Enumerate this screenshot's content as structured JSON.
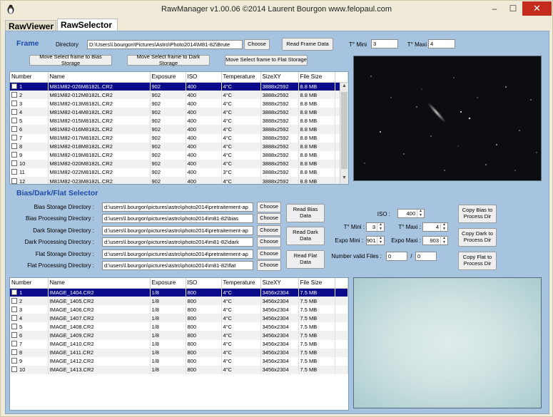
{
  "window": {
    "title": "RawManager v1.00.06 ©2014 Laurent Bourgon  www.felopaul.com",
    "minimize": "–",
    "maximize": "☐",
    "close": "✕"
  },
  "tabs": [
    {
      "label": "RawViewer",
      "active": false
    },
    {
      "label": "RawSelector",
      "active": true
    }
  ],
  "frame": {
    "section_title": "Frame",
    "directory_label": "Directory",
    "directory_value": "D:\\Users\\l.bourgon\\Pictures\\Astro\\Photo2014\\M81-82\\Brute",
    "choose_label": "Choose",
    "read_label": "Read Frame Data",
    "tmin_label": "T° Mini",
    "tmin_value": "3",
    "tmax_label": "T° Maxi",
    "tmax_value": "4",
    "move_bias_label": "Move Select frame to Bias Storage",
    "move_dark_label": "Move Select frame to Dark Storage",
    "move_flat_label": "Move Select frame to Flat Storage"
  },
  "frame_table": {
    "columns": [
      "Number",
      "Name",
      "Exposure",
      "ISO",
      "Temperature",
      "SizeXY",
      "File Size"
    ],
    "rows": [
      [
        "1",
        "M81M82-026M8182L.CR2",
        "902",
        "400",
        "4°C",
        "3888x2592",
        "8.8 MB"
      ],
      [
        "2",
        "M81M82-012M8182L.CR2",
        "902",
        "400",
        "4°C",
        "3888x2592",
        "8.8 MB"
      ],
      [
        "3",
        "M81M82-013M8182L.CR2",
        "902",
        "400",
        "4°C",
        "3888x2592",
        "8.8 MB"
      ],
      [
        "4",
        "M81M82-014M8182L.CR2",
        "902",
        "400",
        "4°C",
        "3888x2592",
        "8.8 MB"
      ],
      [
        "5",
        "M81M82-015M8182L.CR2",
        "902",
        "400",
        "4°C",
        "3888x2592",
        "8.8 MB"
      ],
      [
        "6",
        "M81M82-016M8182L.CR2",
        "902",
        "400",
        "4°C",
        "3888x2592",
        "8.8 MB"
      ],
      [
        "7",
        "M81M82-017M8182L.CR2",
        "902",
        "400",
        "4°C",
        "3888x2592",
        "8.8 MB"
      ],
      [
        "8",
        "M81M82-018M8182L.CR2",
        "902",
        "400",
        "4°C",
        "3888x2592",
        "8.8 MB"
      ],
      [
        "9",
        "M81M82-019M8182L.CR2",
        "902",
        "400",
        "4°C",
        "3888x2592",
        "8.8 MB"
      ],
      [
        "10",
        "M81M82-020M8182L.CR2",
        "902",
        "400",
        "4°C",
        "3888x2592",
        "8.8 MB"
      ],
      [
        "11",
        "M81M82-022M8182L.CR2",
        "902",
        "400",
        "3°C",
        "3888x2592",
        "8.8 MB"
      ],
      [
        "12",
        "M81M82-023M8182L.CR2",
        "902",
        "400",
        "4°C",
        "3888x2592",
        "8.8 MB"
      ]
    ],
    "selected_row": 0
  },
  "selector": {
    "section_title": "Bias/Dark/Flat Selector",
    "dirs": [
      {
        "label": "Bias Storage Directory :",
        "value": "d:\\users\\l.bourgon\\pictures\\astro\\photo2014\\pretraitement-ap",
        "choose": "Choose"
      },
      {
        "label": "Bias Processing Directory :",
        "value": "d:\\users\\l.bourgon\\pictures\\astro\\photo2014\\m81-82\\bias",
        "choose": "Choose"
      },
      {
        "label": "Dark Storage Directory :",
        "value": "d:\\users\\l.bourgon\\pictures\\astro\\photo2014\\pretraitement-ap",
        "choose": "Choose"
      },
      {
        "label": "Dark Processing Directory :",
        "value": "d:\\users\\l.bourgon\\pictures\\astro\\photo2014\\m81-82\\dark",
        "choose": "Choose"
      },
      {
        "label": "Flat Storage Directory :",
        "value": "d:\\users\\l.bourgon\\pictures\\astro\\photo2014\\pretraitement-ap",
        "choose": "Choose"
      },
      {
        "label": "Flat Processing Directory :",
        "value": "d:\\users\\l.bourgon\\pictures\\astro\\photo2014\\m81-82\\flat",
        "choose": "Choose"
      }
    ],
    "read_bias": "Read Bias Data",
    "read_dark": "Read Dark Data",
    "read_flat": "Read Flat Data",
    "iso_label": "ISO :",
    "iso_value": "400",
    "tmin_label": "T° Mini :",
    "tmin_value": "3",
    "tmax_label": "T° Maxi :",
    "tmax_value": "4",
    "expo_min_label": "Expo Mini :",
    "expo_min_value": "901",
    "expo_max_label": "Expo Maxi :",
    "expo_max_value": "903",
    "valid_label": "Number valid Files :",
    "valid_value1": "0",
    "valid_sep": "/",
    "valid_value2": "0",
    "copy_bias": "Copy Bias to Process Dir",
    "copy_dark": "Copy Dark to Process Dir",
    "copy_flat": "Copy Flat to Process Dir"
  },
  "selector_table": {
    "columns": [
      "Number",
      "Name",
      "Exposure",
      "ISO",
      "Temperature",
      "SizeXY",
      "File Size"
    ],
    "rows": [
      [
        "1",
        "IMAGE_1404.CR2",
        "1/8",
        "800",
        "4°C",
        "3456x2304",
        "7.5 MB"
      ],
      [
        "2",
        "IMAGE_1405.CR2",
        "1/8",
        "800",
        "4°C",
        "3456x2304",
        "7.5 MB"
      ],
      [
        "3",
        "IMAGE_1406.CR2",
        "1/8",
        "800",
        "4°C",
        "3456x2304",
        "7.5 MB"
      ],
      [
        "4",
        "IMAGE_1407.CR2",
        "1/8",
        "800",
        "4°C",
        "3456x2304",
        "7.5 MB"
      ],
      [
        "5",
        "IMAGE_1408.CR2",
        "1/8",
        "800",
        "4°C",
        "3456x2304",
        "7.5 MB"
      ],
      [
        "6",
        "IMAGE_1409.CR2",
        "1/8",
        "800",
        "4°C",
        "3456x2304",
        "7.5 MB"
      ],
      [
        "7",
        "IMAGE_1410.CR2",
        "1/8",
        "800",
        "4°C",
        "3456x2304",
        "7.5 MB"
      ],
      [
        "8",
        "IMAGE_1411.CR2",
        "1/8",
        "800",
        "4°C",
        "3456x2304",
        "7.5 MB"
      ],
      [
        "9",
        "IMAGE_1412.CR2",
        "1/8",
        "800",
        "4°C",
        "3456x2304",
        "7.5 MB"
      ],
      [
        "10",
        "IMAGE_1413.CR2",
        "1/8",
        "800",
        "4°C",
        "3456x2304",
        "7.5 MB"
      ]
    ],
    "selected_row": 0
  },
  "colors": {
    "panel_bg": "#a6c4df",
    "section_title": "#1f4aa8",
    "selection": "#0a0a8a",
    "close_button": "#c42b1c"
  },
  "icons": {
    "app": "penguin-icon",
    "scroll_up": "▲",
    "scroll_down": "▼"
  }
}
